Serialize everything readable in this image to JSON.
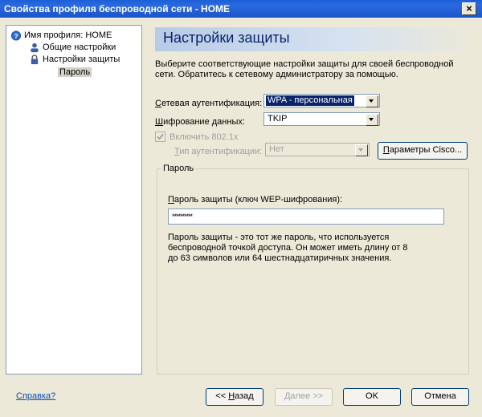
{
  "window": {
    "title": "Свойства профиля беспроводной сети - HOME",
    "close_label": "×"
  },
  "tree": {
    "items": [
      {
        "label": "Имя профиля: HOME",
        "icon": "help-circle-icon"
      },
      {
        "label": "Общие настройки",
        "icon": "users-icon"
      },
      {
        "label": "Настройки защиты",
        "icon": "lock-icon"
      },
      {
        "label": "Пароль",
        "selected": true
      }
    ]
  },
  "main": {
    "header_title": "Настройки защиты",
    "description": "Выберите соответствующие настройки защиты для своей беспроводной сети. Обратитесь к сетевому администратору за помощью.",
    "network_auth": {
      "label": "Сетевая аутентификация:",
      "value": "WPA - персональная"
    },
    "data_encryption": {
      "label": "Шифрование данных:",
      "value": "TKIP"
    },
    "enable_8021x": {
      "label": "Включить 802.1x",
      "checked": true,
      "enabled": false
    },
    "auth_type": {
      "label": "Тип аутентификации:",
      "value": "Нет",
      "enabled": false
    },
    "cisco_button": "Параметры Cisco...",
    "password_group": {
      "legend": "Пароль",
      "field_label": "Пароль защиты (ключ WEP-шифрования):",
      "field_value": "**********",
      "info": "Пароль защиты - это тот же пароль, что используется беспроводной точкой доступа. Он может иметь длину от 8 до 63 символов или 64 шестнадцатиричных значения."
    }
  },
  "footer": {
    "help_link": "Справка?",
    "back_button": "<< Назад",
    "next_button": "Далее >>",
    "ok_button": "OK",
    "cancel_button": "Отмена"
  },
  "colors": {
    "title_bar": "#1d5fd6",
    "header_text": "#0a246a",
    "selection": "#0a246a",
    "link": "#0b4fb0"
  }
}
